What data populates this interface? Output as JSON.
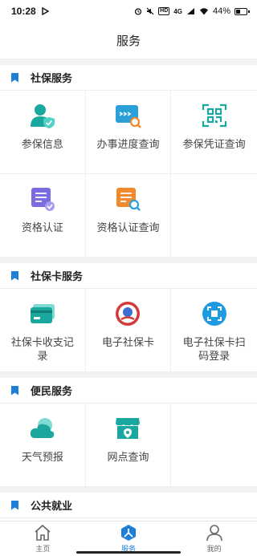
{
  "status_bar": {
    "time": "10:28",
    "network": "4G",
    "battery": "44%"
  },
  "header": {
    "title": "服务"
  },
  "sections": [
    {
      "title": "社保服务",
      "items": [
        {
          "label": "参保信息",
          "icon": "person-shield-icon"
        },
        {
          "label": "办事进度查询",
          "icon": "progress-search-icon"
        },
        {
          "label": "参保凭证查询",
          "icon": "scan-certificate-icon"
        },
        {
          "label": "资格认证",
          "icon": "certificate-check-icon"
        },
        {
          "label": "资格认证查询",
          "icon": "certificate-search-icon"
        }
      ]
    },
    {
      "title": "社保卡服务",
      "items": [
        {
          "label": "社保卡收支记录",
          "icon": "card-records-icon"
        },
        {
          "label": "电子社保卡",
          "icon": "social-security-emblem-icon"
        },
        {
          "label": "电子社保卡扫码登录",
          "icon": "qr-scan-icon"
        }
      ]
    },
    {
      "title": "便民服务",
      "items": [
        {
          "label": "天气预报",
          "icon": "cloud-weather-icon"
        },
        {
          "label": "网点查询",
          "icon": "store-location-icon"
        }
      ]
    },
    {
      "title": "公共就业",
      "items": []
    }
  ],
  "tabbar": [
    {
      "label": "主页",
      "icon": "home-icon",
      "active": false
    },
    {
      "label": "服务",
      "icon": "service-person-icon",
      "active": true
    },
    {
      "label": "我的",
      "icon": "user-profile-icon",
      "active": false
    }
  ],
  "colors": {
    "accent": "#1e7fd8",
    "teal": "#1aa79e",
    "purple": "#7b6be0",
    "orange": "#f08a2c"
  }
}
